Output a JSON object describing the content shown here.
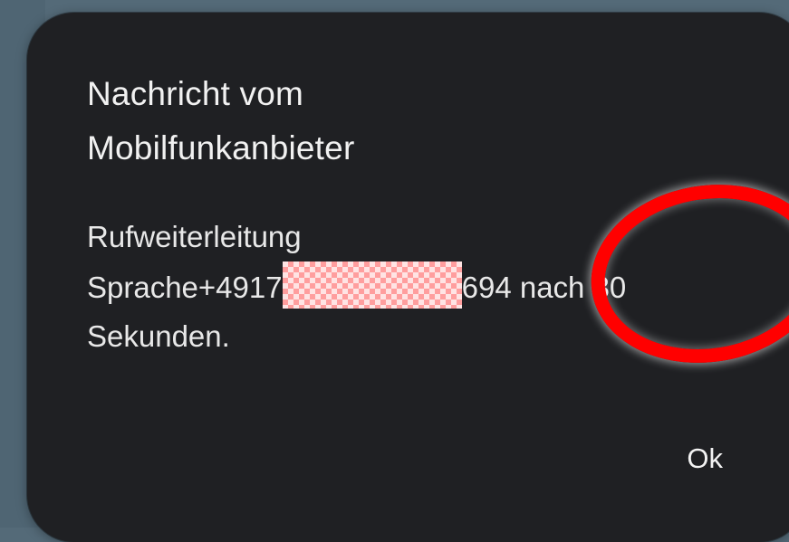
{
  "dialog": {
    "title": "Nachricht vom Mobilfunkanbieter",
    "message": {
      "line1": "Rufweiterleitung",
      "line2_prefix": "Sprache+4917",
      "line2_suffix": "694 nach 30",
      "line3": "Sekunden."
    },
    "ok_label": "Ok"
  },
  "colors": {
    "background": "#546a78",
    "dialog_background": "#1f2023",
    "text": "#f1f1f1",
    "annotation_red": "#ff0000",
    "redaction_pink": "#ff9e9e"
  },
  "annotation": {
    "shape": "red-circle"
  }
}
